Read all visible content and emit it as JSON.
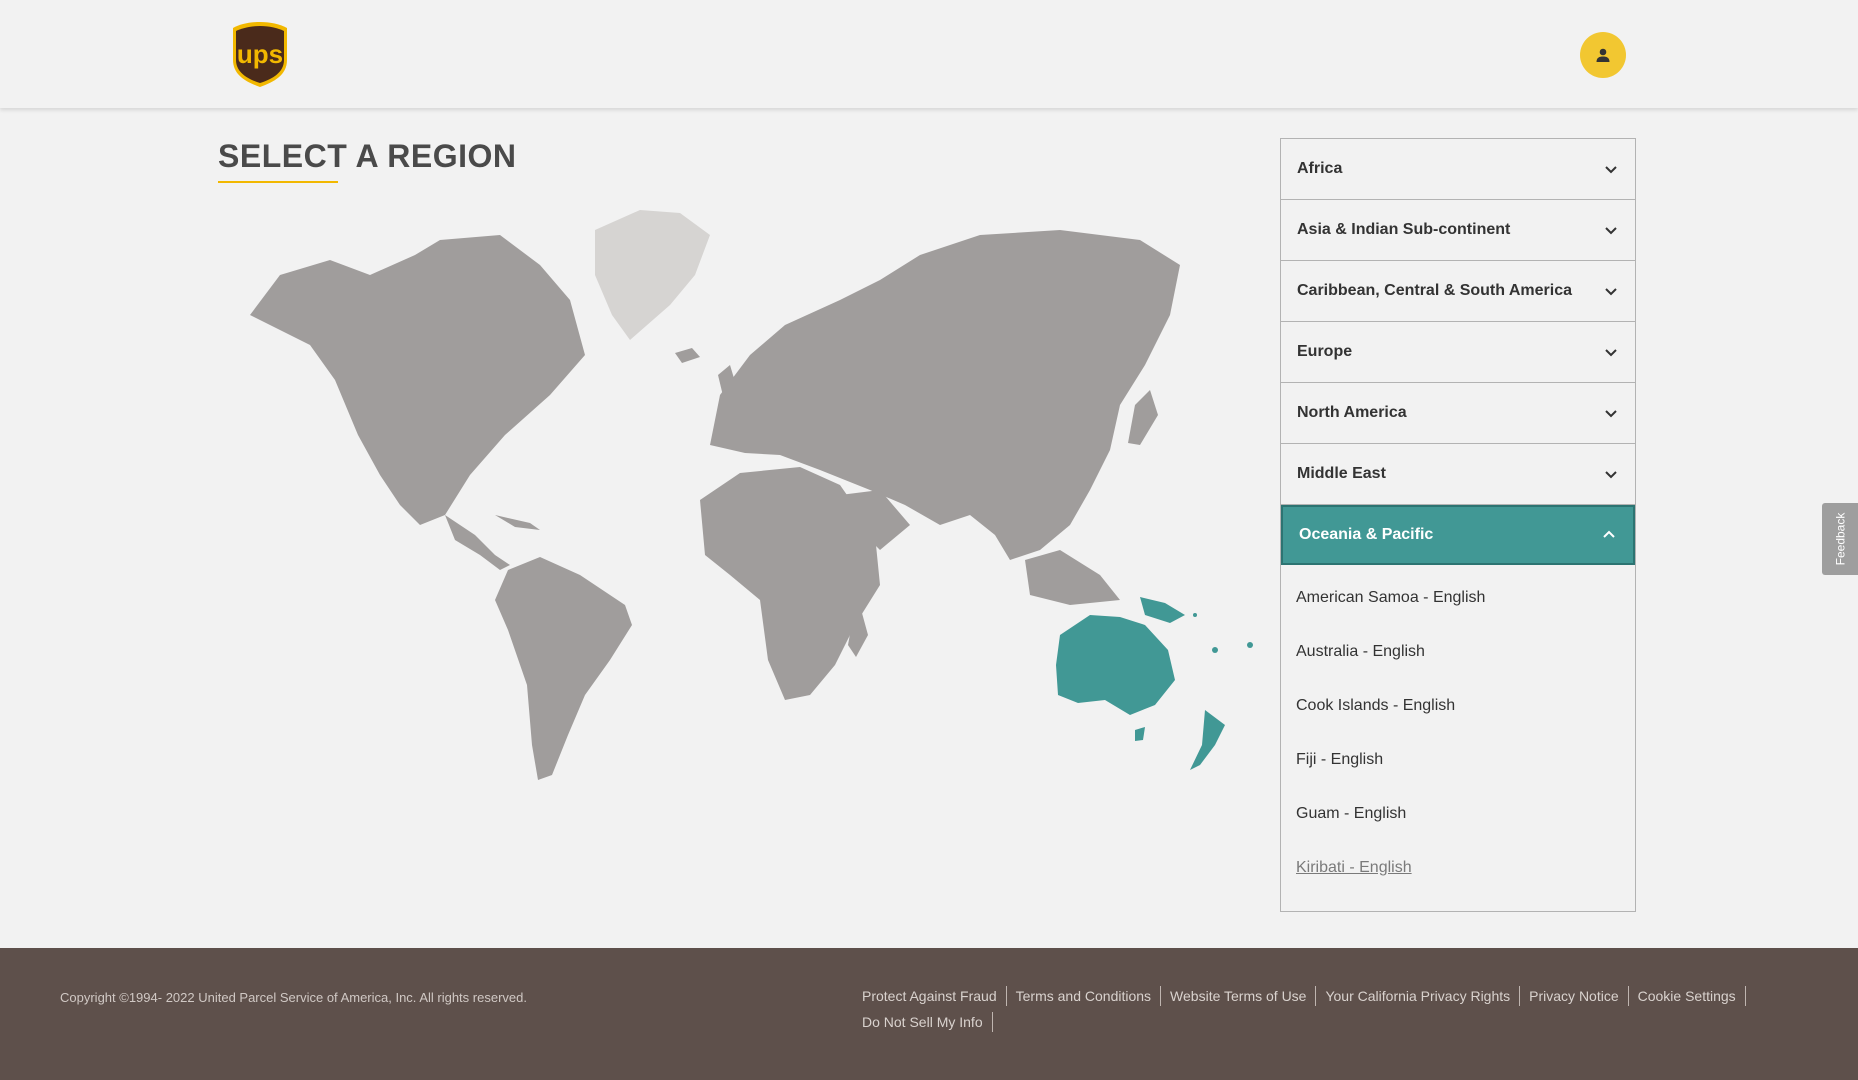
{
  "header": {
    "logo_text": "ups",
    "logo_icon": "ups-shield-logo",
    "user_icon": "user-icon"
  },
  "main": {
    "title": "SELECT A REGION"
  },
  "colors": {
    "accent_teal": "#419895",
    "ups_gold": "#f2b800",
    "ups_brown": "#4a2a1b",
    "footer_bg": "#5e504b",
    "map_land": "#a09d9c"
  },
  "regions": [
    {
      "label": "Africa",
      "expanded": false
    },
    {
      "label": "Asia & Indian Sub-continent",
      "expanded": false
    },
    {
      "label": "Caribbean, Central & South America",
      "expanded": false
    },
    {
      "label": "Europe",
      "expanded": false
    },
    {
      "label": "North America",
      "expanded": false
    },
    {
      "label": "Middle East",
      "expanded": false
    },
    {
      "label": "Oceania & Pacific",
      "expanded": true
    }
  ],
  "oceania_countries": [
    "American Samoa - English",
    "Australia - English",
    "Cook Islands - English",
    "Fiji - English",
    "Guam - English",
    "Kiribati - English"
  ],
  "feedback": {
    "label": "Feedback"
  },
  "footer": {
    "copyright": "Copyright ©1994- 2022  United Parcel Service of America, Inc. All rights reserved.",
    "links": [
      "Protect Against Fraud",
      "Terms and Conditions",
      "Website Terms of Use",
      "Your California Privacy Rights",
      "Privacy Notice",
      "Cookie Settings",
      "Do Not Sell My Info"
    ]
  }
}
